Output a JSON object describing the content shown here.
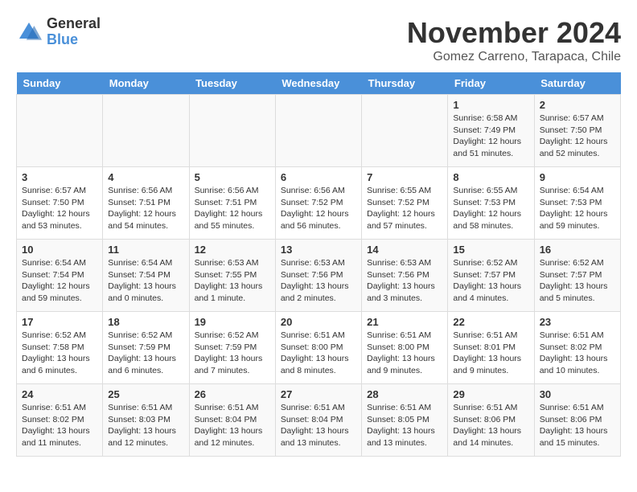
{
  "header": {
    "logo_general": "General",
    "logo_blue": "Blue",
    "month_year": "November 2024",
    "location": "Gomez Carreno, Tarapaca, Chile"
  },
  "days_of_week": [
    "Sunday",
    "Monday",
    "Tuesday",
    "Wednesday",
    "Thursday",
    "Friday",
    "Saturday"
  ],
  "weeks": [
    [
      {
        "day": "",
        "info": ""
      },
      {
        "day": "",
        "info": ""
      },
      {
        "day": "",
        "info": ""
      },
      {
        "day": "",
        "info": ""
      },
      {
        "day": "",
        "info": ""
      },
      {
        "day": "1",
        "info": "Sunrise: 6:58 AM\nSunset: 7:49 PM\nDaylight: 12 hours\nand 51 minutes."
      },
      {
        "day": "2",
        "info": "Sunrise: 6:57 AM\nSunset: 7:50 PM\nDaylight: 12 hours\nand 52 minutes."
      }
    ],
    [
      {
        "day": "3",
        "info": "Sunrise: 6:57 AM\nSunset: 7:50 PM\nDaylight: 12 hours\nand 53 minutes."
      },
      {
        "day": "4",
        "info": "Sunrise: 6:56 AM\nSunset: 7:51 PM\nDaylight: 12 hours\nand 54 minutes."
      },
      {
        "day": "5",
        "info": "Sunrise: 6:56 AM\nSunset: 7:51 PM\nDaylight: 12 hours\nand 55 minutes."
      },
      {
        "day": "6",
        "info": "Sunrise: 6:56 AM\nSunset: 7:52 PM\nDaylight: 12 hours\nand 56 minutes."
      },
      {
        "day": "7",
        "info": "Sunrise: 6:55 AM\nSunset: 7:52 PM\nDaylight: 12 hours\nand 57 minutes."
      },
      {
        "day": "8",
        "info": "Sunrise: 6:55 AM\nSunset: 7:53 PM\nDaylight: 12 hours\nand 58 minutes."
      },
      {
        "day": "9",
        "info": "Sunrise: 6:54 AM\nSunset: 7:53 PM\nDaylight: 12 hours\nand 59 minutes."
      }
    ],
    [
      {
        "day": "10",
        "info": "Sunrise: 6:54 AM\nSunset: 7:54 PM\nDaylight: 12 hours\nand 59 minutes."
      },
      {
        "day": "11",
        "info": "Sunrise: 6:54 AM\nSunset: 7:54 PM\nDaylight: 13 hours\nand 0 minutes."
      },
      {
        "day": "12",
        "info": "Sunrise: 6:53 AM\nSunset: 7:55 PM\nDaylight: 13 hours\nand 1 minute."
      },
      {
        "day": "13",
        "info": "Sunrise: 6:53 AM\nSunset: 7:56 PM\nDaylight: 13 hours\nand 2 minutes."
      },
      {
        "day": "14",
        "info": "Sunrise: 6:53 AM\nSunset: 7:56 PM\nDaylight: 13 hours\nand 3 minutes."
      },
      {
        "day": "15",
        "info": "Sunrise: 6:52 AM\nSunset: 7:57 PM\nDaylight: 13 hours\nand 4 minutes."
      },
      {
        "day": "16",
        "info": "Sunrise: 6:52 AM\nSunset: 7:57 PM\nDaylight: 13 hours\nand 5 minutes."
      }
    ],
    [
      {
        "day": "17",
        "info": "Sunrise: 6:52 AM\nSunset: 7:58 PM\nDaylight: 13 hours\nand 6 minutes."
      },
      {
        "day": "18",
        "info": "Sunrise: 6:52 AM\nSunset: 7:59 PM\nDaylight: 13 hours\nand 6 minutes."
      },
      {
        "day": "19",
        "info": "Sunrise: 6:52 AM\nSunset: 7:59 PM\nDaylight: 13 hours\nand 7 minutes."
      },
      {
        "day": "20",
        "info": "Sunrise: 6:51 AM\nSunset: 8:00 PM\nDaylight: 13 hours\nand 8 minutes."
      },
      {
        "day": "21",
        "info": "Sunrise: 6:51 AM\nSunset: 8:00 PM\nDaylight: 13 hours\nand 9 minutes."
      },
      {
        "day": "22",
        "info": "Sunrise: 6:51 AM\nSunset: 8:01 PM\nDaylight: 13 hours\nand 9 minutes."
      },
      {
        "day": "23",
        "info": "Sunrise: 6:51 AM\nSunset: 8:02 PM\nDaylight: 13 hours\nand 10 minutes."
      }
    ],
    [
      {
        "day": "24",
        "info": "Sunrise: 6:51 AM\nSunset: 8:02 PM\nDaylight: 13 hours\nand 11 minutes."
      },
      {
        "day": "25",
        "info": "Sunrise: 6:51 AM\nSunset: 8:03 PM\nDaylight: 13 hours\nand 12 minutes."
      },
      {
        "day": "26",
        "info": "Sunrise: 6:51 AM\nSunset: 8:04 PM\nDaylight: 13 hours\nand 12 minutes."
      },
      {
        "day": "27",
        "info": "Sunrise: 6:51 AM\nSunset: 8:04 PM\nDaylight: 13 hours\nand 13 minutes."
      },
      {
        "day": "28",
        "info": "Sunrise: 6:51 AM\nSunset: 8:05 PM\nDaylight: 13 hours\nand 13 minutes."
      },
      {
        "day": "29",
        "info": "Sunrise: 6:51 AM\nSunset: 8:06 PM\nDaylight: 13 hours\nand 14 minutes."
      },
      {
        "day": "30",
        "info": "Sunrise: 6:51 AM\nSunset: 8:06 PM\nDaylight: 13 hours\nand 15 minutes."
      }
    ]
  ]
}
